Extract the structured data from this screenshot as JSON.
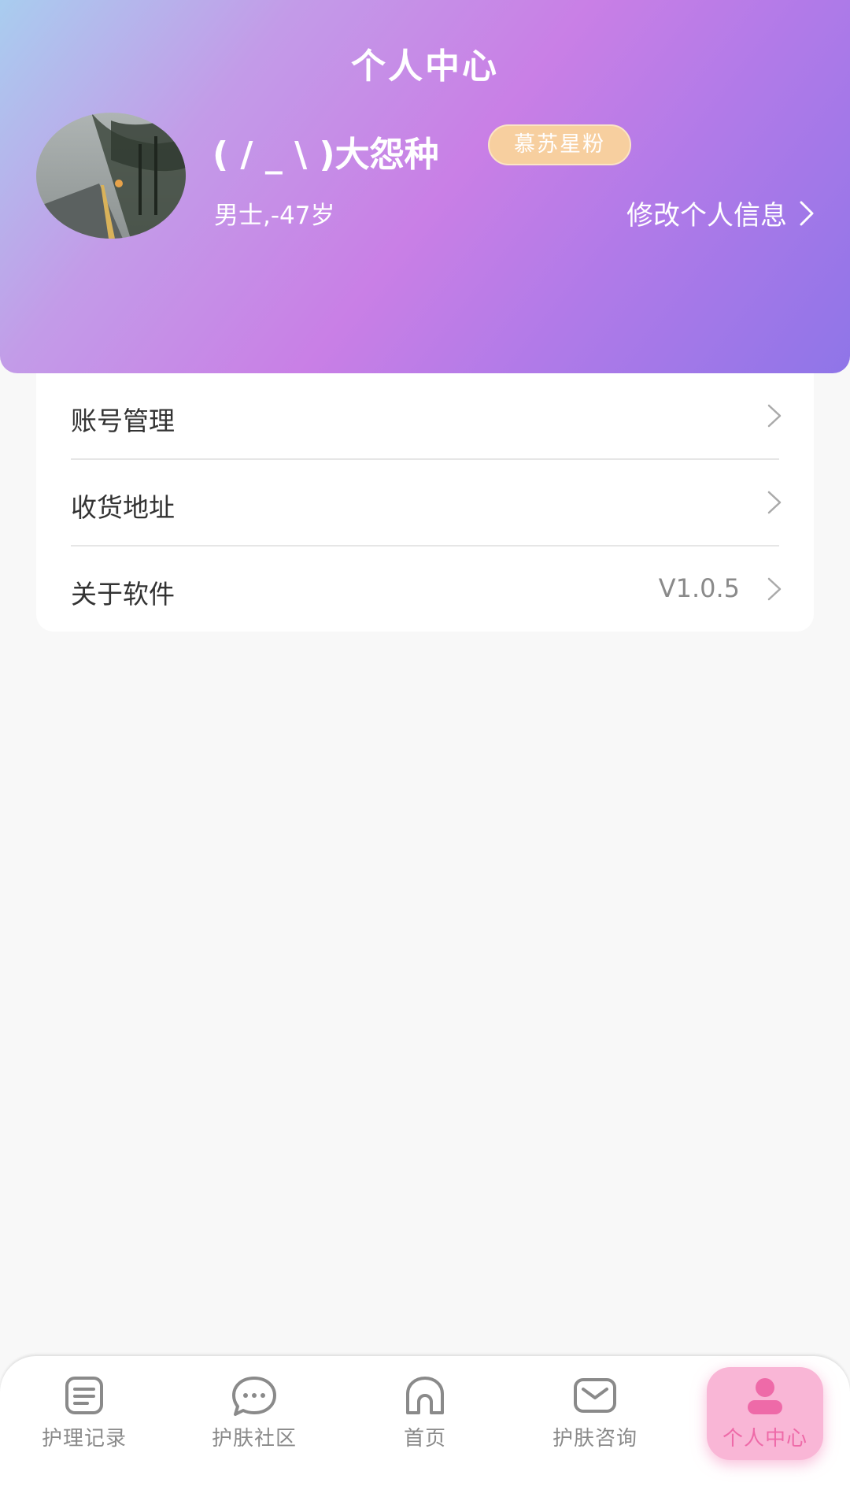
{
  "header": {
    "title": "个人中心",
    "user_name": "( / _ \\ )大怨种",
    "badge": "慕苏星粉",
    "meta": "男士,-47岁",
    "edit_label": "修改个人信息"
  },
  "menu": {
    "items": [
      {
        "label": "账号管理",
        "value": ""
      },
      {
        "label": "收货地址",
        "value": ""
      },
      {
        "label": "关于软件",
        "value": "V1.0.5"
      }
    ]
  },
  "tabbar": {
    "active_color": "#ee6aa8",
    "items": [
      {
        "label": "护理记录",
        "icon": "list-icon",
        "active": false
      },
      {
        "label": "护肤社区",
        "icon": "chat-bubble-icon",
        "active": false
      },
      {
        "label": "首页",
        "icon": "home-icon",
        "active": false
      },
      {
        "label": "护肤咨询",
        "icon": "mail-icon",
        "active": false
      },
      {
        "label": "个人中心",
        "icon": "user-icon",
        "active": true
      }
    ]
  }
}
